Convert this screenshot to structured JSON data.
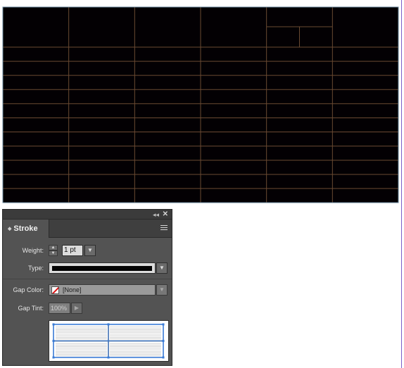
{
  "table": {
    "rows": 12,
    "columns": 6,
    "header_cell_split": true,
    "line_color": "#6a4a32",
    "fill_color": "#030003",
    "border_color": "#6e8da0"
  },
  "page_guide_color": "#7b5ec9",
  "panel": {
    "title": "Stroke",
    "weight": {
      "label": "Weight:",
      "value": "1 pt"
    },
    "type": {
      "label": "Type:",
      "line_color": "#050505"
    },
    "gap_color": {
      "label": "Gap Color:",
      "value": "[None]"
    },
    "gap_tint": {
      "label": "Gap Tint:",
      "value": "100%"
    },
    "proxy": {
      "selection_color": "#3a7bd5"
    }
  },
  "icons": [
    "collapse-icon",
    "close-icon",
    "panel-menu-icon",
    "stepper-up-icon",
    "stepper-down-icon",
    "dropdown-arrow-icon",
    "none-swatch-icon",
    "apply-arrow-icon"
  ]
}
